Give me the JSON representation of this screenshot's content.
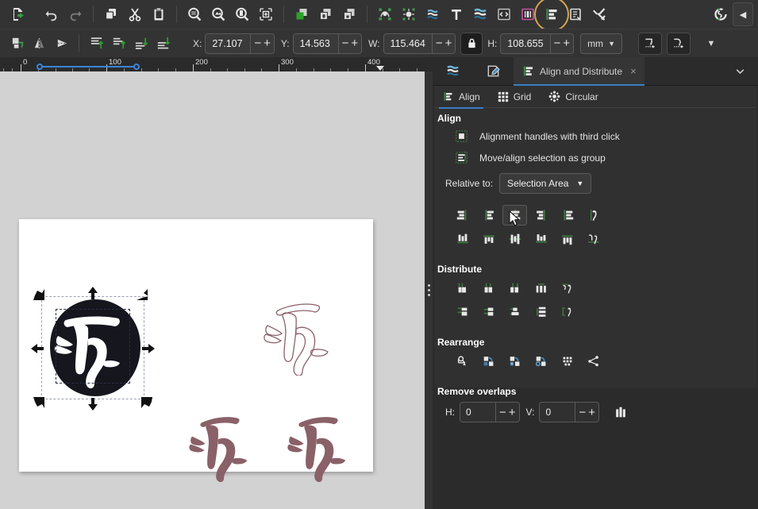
{
  "toolbar_top": {
    "buttons": [
      {
        "name": "export-icon",
        "title": "Export"
      },
      {
        "name": "undo-icon",
        "title": "Undo"
      },
      {
        "name": "redo-icon",
        "title": "Redo"
      },
      {
        "name": "copy-icon",
        "title": "Copy"
      },
      {
        "name": "cut-icon",
        "title": "Cut"
      },
      {
        "name": "paste-icon",
        "title": "Paste"
      },
      {
        "name": "zoom-selection-icon",
        "title": "Zoom selection"
      },
      {
        "name": "zoom-drawing-icon",
        "title": "Zoom drawing"
      },
      {
        "name": "zoom-page-icon",
        "title": "Zoom page"
      },
      {
        "name": "zoom-fit-icon",
        "title": "Zoom fit"
      },
      {
        "name": "duplicate-icon",
        "title": "Duplicate"
      },
      {
        "name": "group-icon",
        "title": "Group"
      },
      {
        "name": "ungroup-icon",
        "title": "Ungroup"
      },
      {
        "name": "object-to-path-icon",
        "title": "Object to path"
      },
      {
        "name": "stroke-to-path-icon",
        "title": "Stroke to path"
      },
      {
        "name": "fill-stroke-icon",
        "title": "Fill and stroke"
      },
      {
        "name": "text-icon",
        "title": "Text and font"
      },
      {
        "name": "layers-icon",
        "title": "Layers"
      },
      {
        "name": "xml-editor-icon",
        "title": "XML editor"
      },
      {
        "name": "objects-icon",
        "title": "Objects"
      },
      {
        "name": "align-distribute-icon",
        "title": "Align and Distribute",
        "highlighted": true
      },
      {
        "name": "document-properties-icon",
        "title": "Document properties"
      },
      {
        "name": "preferences-icon",
        "title": "Preferences"
      },
      {
        "name": "snap-controls-icon",
        "title": "Snap controls"
      }
    ],
    "collapse_label": "◀"
  },
  "toolbar_selection": {
    "icons": [
      {
        "name": "select-all-icon"
      },
      {
        "name": "flip-horizontal-icon"
      },
      {
        "name": "flip-vertical-icon"
      },
      {
        "name": "raise-to-top-icon"
      },
      {
        "name": "raise-icon"
      },
      {
        "name": "lower-icon"
      },
      {
        "name": "lower-to-bottom-icon"
      }
    ],
    "fields": [
      {
        "label": "X:",
        "value": "27.107"
      },
      {
        "label": "Y:",
        "value": "14.563"
      },
      {
        "label": "W:",
        "value": "115.464"
      },
      {
        "label": "H:",
        "value": "108.655"
      }
    ],
    "lock_icon": "lock-icon",
    "units": "mm",
    "toggle_icons": [
      "scale-stroke-icon",
      "scale-corners-icon"
    ],
    "overflow_label": "▼",
    "minus": "−",
    "plus": "+"
  },
  "ruler": {
    "labels": [
      "0",
      "100",
      "200",
      "300",
      "400"
    ],
    "label_positions": [
      26,
      134,
      243,
      351,
      460
    ],
    "selection": {
      "start": 50,
      "end": 172
    }
  },
  "canvas": {
    "page_name": "drawing-page",
    "objects": [
      {
        "name": "selected-glyph-black",
        "selected": true
      },
      {
        "name": "outline-glyph"
      },
      {
        "name": "filled-glyph-1"
      },
      {
        "name": "filled-glyph-2"
      }
    ],
    "glyph_stroke_color": "#8a6168",
    "glyph_fill_color": "#8a6168",
    "page_bg": "#ffffff",
    "canvas_bg": "#d2d2d2"
  },
  "panel": {
    "tabs": [
      {
        "name": "tab-layers",
        "label": "",
        "icon": "layers-icon",
        "active": false
      },
      {
        "name": "tab-objects",
        "label": "",
        "icon": "object-properties-icon",
        "active": false
      },
      {
        "name": "tab-align-distribute",
        "label": "Align and Distribute",
        "icon": "align-icon",
        "active": true,
        "closable": true,
        "close_label": "×"
      }
    ],
    "chevron": "⌄",
    "subtabs": [
      {
        "name": "subtab-align",
        "label": "Align",
        "icon": "align-icon",
        "active": true
      },
      {
        "name": "subtab-grid",
        "label": "Grid",
        "icon": "grid-icon",
        "active": false
      },
      {
        "name": "subtab-circular",
        "label": "Circular",
        "icon": "circular-icon",
        "active": false
      }
    ],
    "align": {
      "section_title": "Align",
      "option_handles": "Alignment handles with third click",
      "option_group": "Move/align selection as group",
      "relative_label": "Relative to:",
      "relative_value": "Selection Area",
      "relative_caret": "▼",
      "row1": [
        {
          "name": "align-right-edge-to-anchor-left",
          "hover": false
        },
        {
          "name": "align-left-edges",
          "hover": false
        },
        {
          "name": "align-horizontal-centers",
          "hover": true
        },
        {
          "name": "align-right-edges",
          "hover": false
        },
        {
          "name": "align-left-edge-to-anchor-right",
          "hover": false
        },
        {
          "name": "align-text-anchors-horizontal",
          "hover": false
        }
      ],
      "row2": [
        {
          "name": "align-bottom-to-anchor-top"
        },
        {
          "name": "align-top-edges"
        },
        {
          "name": "align-vertical-centers"
        },
        {
          "name": "align-bottom-edges"
        },
        {
          "name": "align-top-to-anchor-bottom"
        },
        {
          "name": "align-text-baselines"
        }
      ]
    },
    "distribute": {
      "section_title": "Distribute",
      "row1": [
        {
          "name": "distribute-left-edges"
        },
        {
          "name": "distribute-horizontal-centers"
        },
        {
          "name": "distribute-right-edges"
        },
        {
          "name": "distribute-horizontal-gaps"
        },
        {
          "name": "distribute-text-anchors-horizontal"
        }
      ],
      "row2": [
        {
          "name": "distribute-top-edges"
        },
        {
          "name": "distribute-vertical-centers"
        },
        {
          "name": "distribute-bottom-edges"
        },
        {
          "name": "distribute-vertical-gaps"
        },
        {
          "name": "distribute-text-baselines"
        }
      ]
    },
    "rearrange": {
      "section_title": "Rearrange",
      "buttons": [
        {
          "name": "graph-layout"
        },
        {
          "name": "exchange-selection-order"
        },
        {
          "name": "exchange-selection-zorder"
        },
        {
          "name": "exchange-selection-clockwise"
        },
        {
          "name": "randomize-positions"
        },
        {
          "name": "unclump-objects"
        }
      ]
    },
    "remove_overlaps": {
      "section_title": "Remove overlaps",
      "h_label": "H:",
      "h_value": "0",
      "v_label": "V:",
      "v_value": "0",
      "minus": "−",
      "plus": "+",
      "action_name": "remove-overlaps-button"
    }
  },
  "colors": {
    "accent_blue": "#3a7fc4",
    "highlight_gold": "#d6a450",
    "icon_green": "#3f7d44",
    "panel_bg": "#303030",
    "toolbar_bg": "#333333",
    "app_bg": "#2b2b2b"
  }
}
